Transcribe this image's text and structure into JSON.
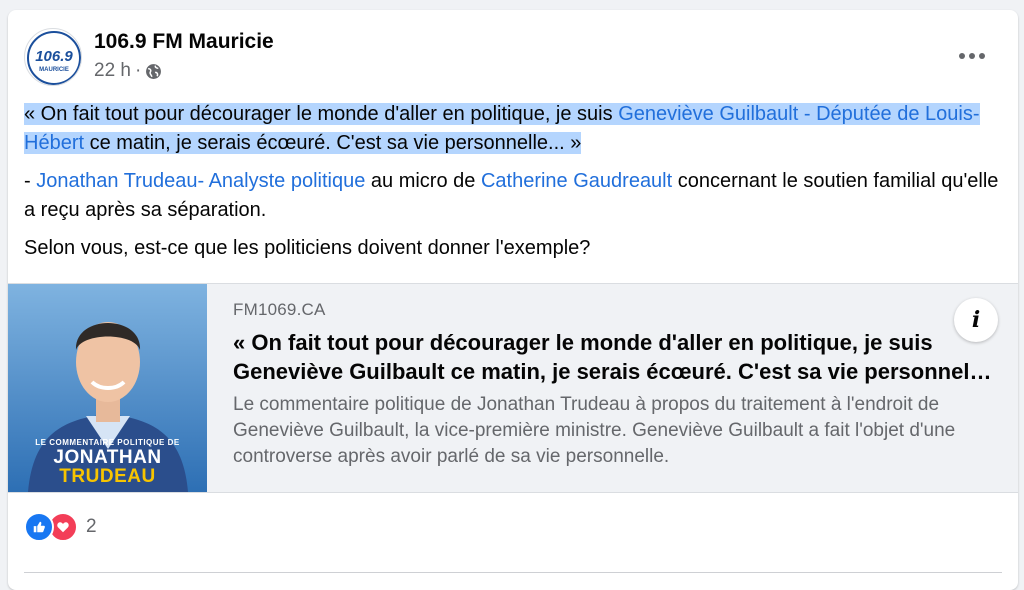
{
  "post": {
    "page_name": "106.9 FM Mauricie",
    "time": "22 h",
    "separator": "·",
    "audience_icon": "globe-icon",
    "more_icon": "more-horizontal-icon",
    "avatar": {
      "line1": "106.9",
      "line2": "MAURICIE"
    },
    "text": {
      "quote_part1": "« On fait tout pour décourager le monde d'aller en politique, je suis ",
      "quote_link": "Geneviève Guilbault - Députée de Louis-Hébert",
      "quote_part2": " ce matin, je serais écœuré. C'est sa vie personnelle... »",
      "attrib_prefix": "- ",
      "attrib_link1": "Jonathan Trudeau- Analyste politique",
      "attrib_mid": " au micro de ",
      "attrib_link2": "Catherine Gaudreault",
      "attrib_suffix": " concernant le soutien familial qu'elle a reçu après sa séparation.",
      "question": "Selon vous, est-ce que les politiciens doivent donner l'exemple?"
    }
  },
  "link_preview": {
    "domain": "FM1069.CA",
    "title": "« On fait tout pour décourager le monde d'aller en politique, je suis Geneviève Guilbault ce matin, je serais écœuré. C'est sa vie personnelle »",
    "description": "Le commentaire politique de Jonathan Trudeau à propos du traitement à l'endroit de Geneviève Guilbault, la vice-première ministre. Geneviève Guilbault a fait l'objet d'une controverse après avoir parlé de sa vie personnelle.",
    "thumbnail": {
      "line1": "LE COMMENTAIRE POLITIQUE DE",
      "line2": "JONATHAN",
      "line3": "TRUDEAU"
    },
    "info_icon": "info-icon",
    "info_label": "i"
  },
  "reactions": {
    "icons": [
      "like-icon",
      "love-icon"
    ],
    "count": "2"
  },
  "colors": {
    "link": "#216fdb",
    "selection": "#b4d5fe",
    "secondary_text": "#65676b",
    "like": "#1877f2",
    "love": "#f33e58"
  }
}
